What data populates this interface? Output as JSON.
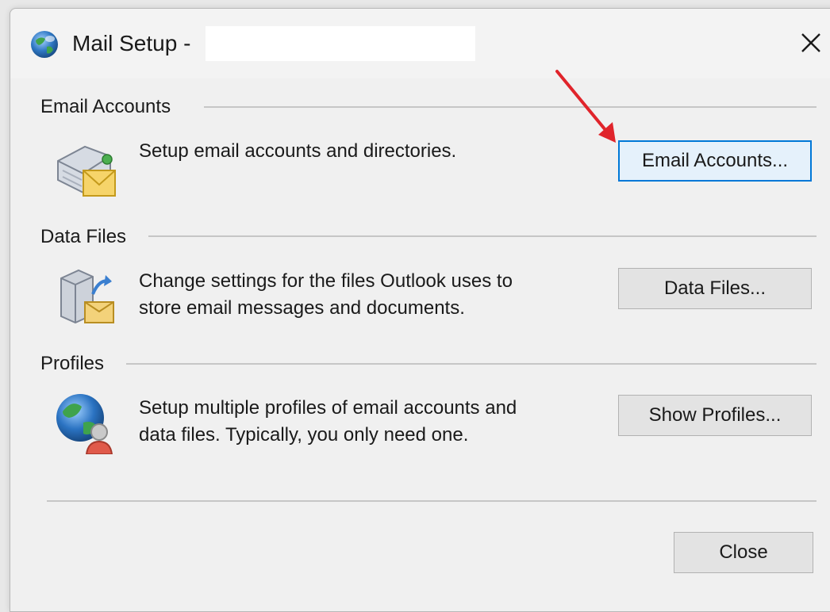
{
  "window": {
    "title": "Mail Setup - ",
    "close_icon": "close-icon",
    "app_icon": "mail-setup-icon"
  },
  "sections": [
    {
      "header": "Email Accounts",
      "icon": "email-accounts-icon",
      "description": "Setup email accounts and directories.",
      "button_label": "Email Accounts..."
    },
    {
      "header": "Data Files",
      "icon": "data-files-icon",
      "description_line1": "Change settings for the files Outlook uses to",
      "description_line2": "store email messages and documents.",
      "button_label": "Data Files..."
    },
    {
      "header": "Profiles",
      "icon": "profiles-icon",
      "description_line1": "Setup multiple profiles of email accounts and",
      "description_line2": "data files. Typically, you only need one.",
      "button_label": "Show Profiles..."
    }
  ],
  "footer": {
    "close_label": "Close"
  },
  "annotation": {
    "arrow_color": "#e0242b",
    "arrow_icon": "red-arrow-annotation"
  },
  "colors": {
    "focus_border": "#0078d7",
    "dialog_bg": "#f0f0f0"
  }
}
